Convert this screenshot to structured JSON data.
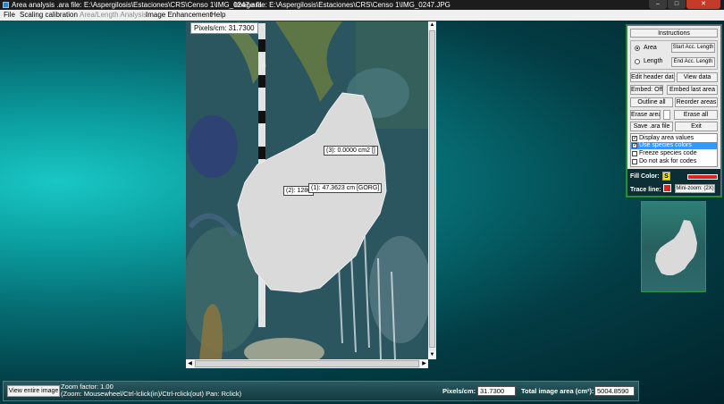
{
  "title_bar": {
    "title": "Area analysis .ara file: E:\\Aspergilosis\\Estaciones\\CRS\\Censo 1\\IMG_0247.ara",
    "image_file": "Image file: E:\\Aspergilosis\\Estaciones\\CRS\\Censo 1\\IMG_0247.JPG",
    "minimize": "–",
    "maximize": "□",
    "close": "✕"
  },
  "menu": {
    "items": [
      "File",
      "Scaling calibration",
      "Area/Length Analysis",
      "Image Enhancement",
      "Help"
    ]
  },
  "image_view": {
    "pixels_label": "Pixels/cm: 31.7300",
    "labels": [
      "(3): 0.0000 cm2 []",
      "(2): 1280",
      "(1): 47.3623 cm [GORG]"
    ]
  },
  "tools": {
    "instructions": "Instructions",
    "area": "Area",
    "length": "Length",
    "start_acc_length": "Start Acc. Length",
    "end_acc_length": "End Acc. Length",
    "edit_header_data": "Edit header data",
    "view_data": "View data",
    "embed_off": "Embed: Off",
    "embed_last_area": "Embed last area",
    "outline_all": "Outline all",
    "reorder_areas": "Reorder areas",
    "erase_area": "Erase area",
    "erase_all": "Erase all",
    "save_ara_file": "Save .ara file",
    "exit": "Exit",
    "options": [
      {
        "label": "Display area values",
        "checked": true,
        "selected": false
      },
      {
        "label": "Use species colors",
        "checked": true,
        "selected": true
      },
      {
        "label": "Freeze species code",
        "checked": false,
        "selected": false
      },
      {
        "label": "Do not ask for codes",
        "checked": false,
        "selected": false
      }
    ],
    "fill_color_label": "Fill Color:",
    "fill_color_value": "S",
    "trace_line_label": "Trace line:",
    "mini_zoom": "Mini-zoom: (2X)",
    "fill_color_swatch": "#f2e600",
    "trace_color_swatch": "#e32020"
  },
  "status": {
    "view_entire_image": "View entire image",
    "zoom_factor": "Zoom factor: 1.00",
    "zoom_hint": "(Zoom: Mousewheel/Ctrl-lclick(in)/Ctrl-rclick(out)  Pan: Rclick)",
    "pixels_cm_label": "Pixels/cm:",
    "pixels_cm_value": "31.7300",
    "total_area_label": "Total image area (cm²):",
    "total_area_value": "5004.8590"
  }
}
